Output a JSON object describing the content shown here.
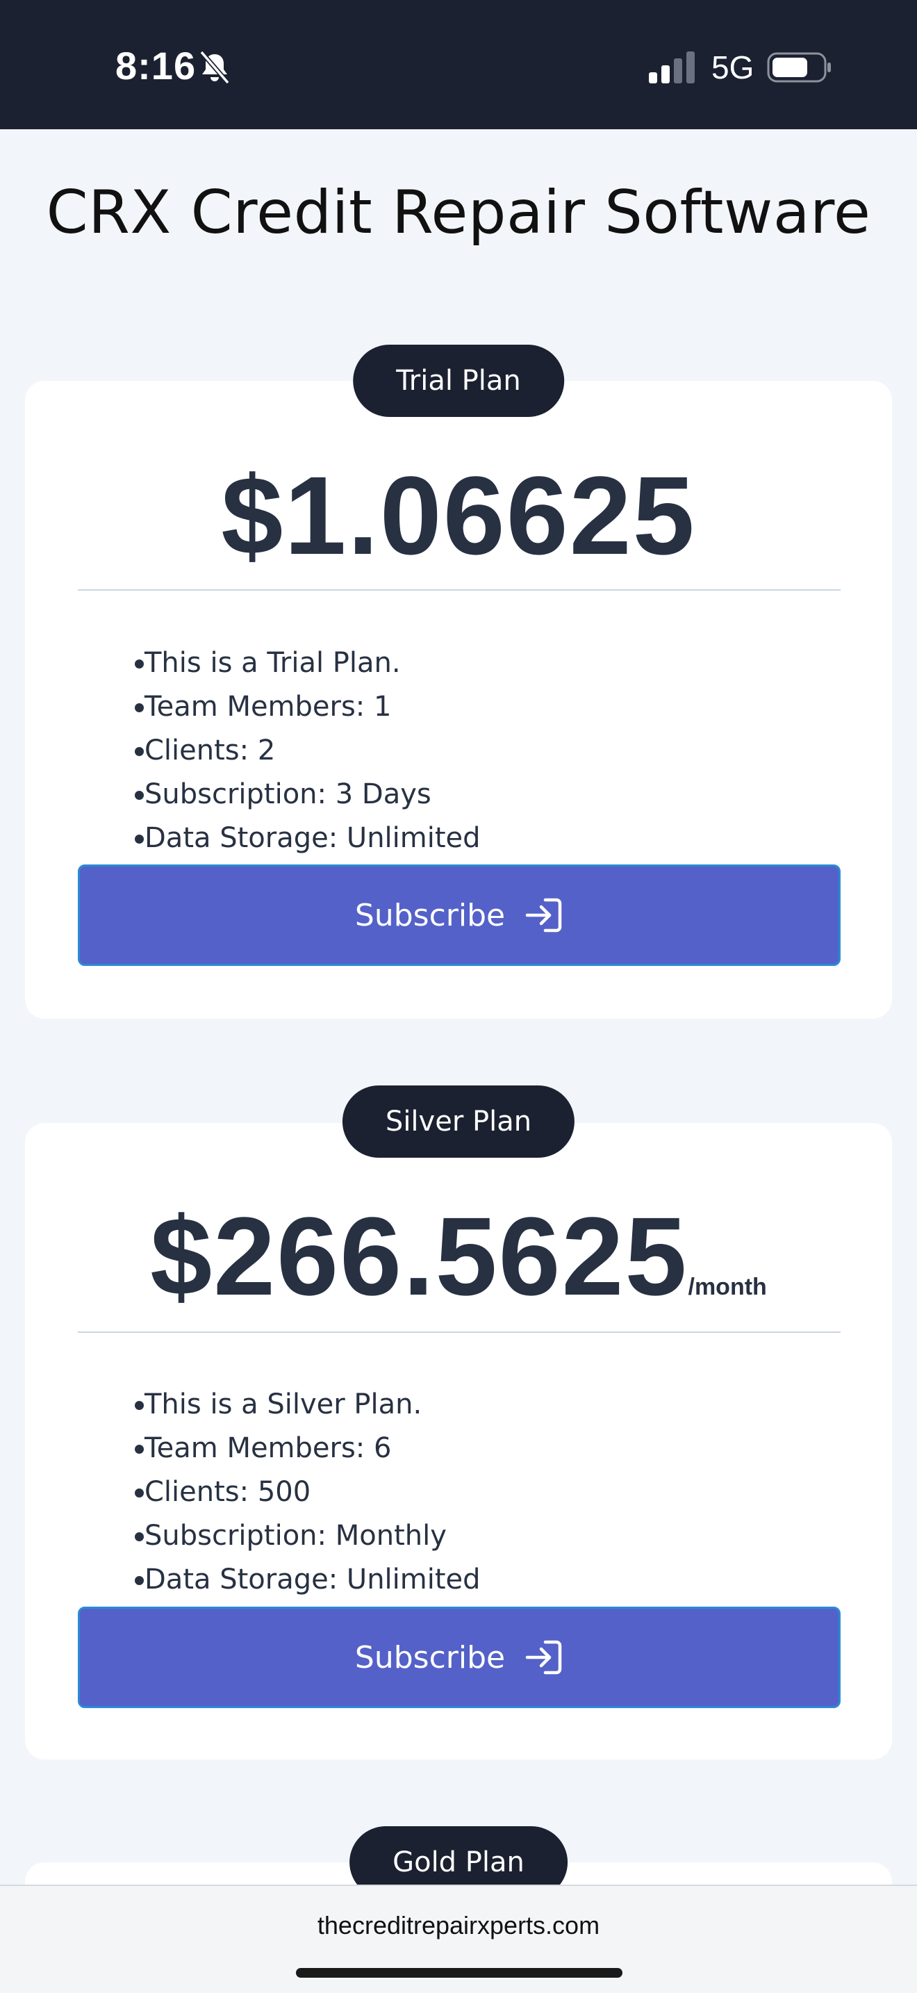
{
  "status_bar": {
    "time": "8:16",
    "network": "5G",
    "icons": [
      "bell-slash-icon",
      "signal-icon",
      "battery-icon"
    ]
  },
  "page": {
    "title": "CRX Credit Repair Software"
  },
  "plans": [
    {
      "name": "Trial Plan",
      "price": "$1.06625",
      "period": "",
      "features": [
        "This is a Trial Plan.",
        "Team Members: 1",
        "Clients: 2",
        "Subscription: 3 Days",
        "Data Storage: Unlimited"
      ],
      "button_label": "Subscribe"
    },
    {
      "name": "Silver Plan",
      "price": "$266.5625",
      "period": "/month",
      "features": [
        "This is a Silver Plan.",
        "Team Members: 6",
        "Clients: 500",
        "Subscription: Monthly",
        "Data Storage: Unlimited"
      ],
      "button_label": "Subscribe"
    },
    {
      "name": "Gold Plan"
    }
  ],
  "browser": {
    "url": "thecreditrepairxperts.com"
  },
  "colors": {
    "header_bg": "#1b2130",
    "page_bg": "#f2f5f9",
    "button_bg": "#5461c8",
    "text": "#273142"
  }
}
